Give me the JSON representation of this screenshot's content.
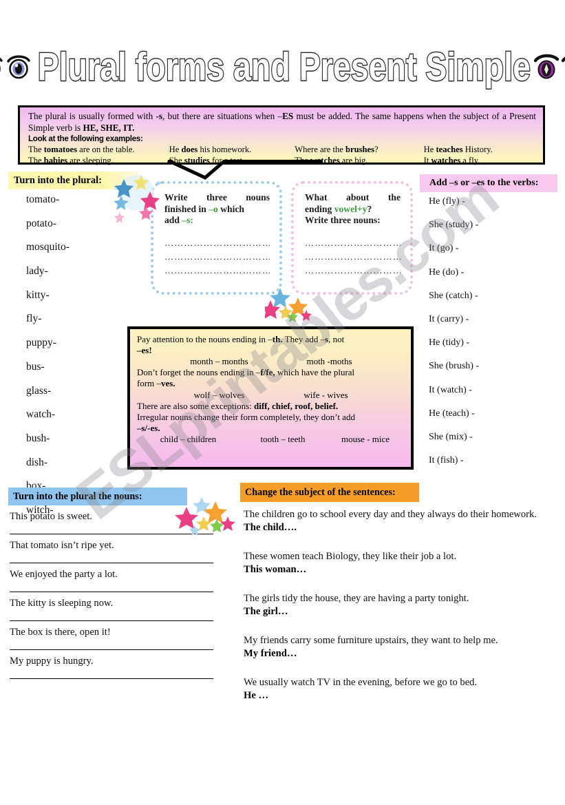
{
  "title": "Plural forms and Present Simple",
  "watermark": "ESLprintables.com",
  "intro": {
    "line1_a": "The plural is usually formed with ",
    "line1_b": "-s",
    "line1_c": ", but there are situations when –",
    "line1_d": "ES",
    "line1_e": " must be added. The same happens when the subject of a Present Simple verb is ",
    "line1_f": "HE, SHE, IT.",
    "lookat": "Look at the following examples:",
    "examples_row1": [
      {
        "pre": "The ",
        "bold": "tomatoes",
        "post": " are on the table."
      },
      {
        "pre": "He ",
        "bold": "does",
        "post": " his homework."
      },
      {
        "pre": "Where are the ",
        "bold": "brushes",
        "post": "?"
      },
      {
        "pre": "He ",
        "bold": "teaches",
        "post": " History."
      }
    ],
    "examples_row2": [
      {
        "pre": "The ",
        "bold": "babies",
        "post": " are sleeping."
      },
      {
        "pre": "She ",
        "bold": "studies",
        "post": " for a test."
      },
      {
        "pre": "The ",
        "bold": "watches",
        "post": " are big."
      },
      {
        "pre": "It ",
        "bold": "watches",
        "post": " a fly."
      }
    ]
  },
  "sections": {
    "plural_heading": "Turn into the plural:",
    "verbs_heading": "Add –s or –es to the verbs:",
    "plural_nouns_heading": "Turn into the plural the nouns:",
    "change_subject_heading": "Change the subject of the sentences:"
  },
  "noun_list": [
    "tomato-",
    "potato-",
    "mosquito-",
    "lady-",
    "kitty-",
    "fly-",
    "puppy-",
    "bus-",
    "glass-",
    "watch-",
    "bush-",
    "dish-",
    "box-",
    "witch-"
  ],
  "verb_list": [
    "He (fly) -",
    "She (study) -",
    "It (go) -",
    "He (do) -",
    "She (catch) -",
    "It (carry) -",
    "He (tidy) -",
    "She (brush) -",
    "It (watch) -",
    "He (teach) -",
    "She (mix) -",
    "It (fish) -"
  ],
  "task_box_1": {
    "l1": "Write three nouns",
    "l2_a": "finished in ",
    "l2_b": "–o",
    "l2_c": " which",
    "l3_a": "add ",
    "l3_b": "–s:",
    "blank": "……………………………."
  },
  "task_box_2": {
    "l1": "What about the",
    "l2_a": "ending ",
    "l2_b": "vowel+y",
    "l2_c": "?",
    "l3": "Write three nouns:",
    "blank": "……………………………."
  },
  "rules": {
    "p1_a": "Pay attention to the nouns ending in –",
    "p1_b": "th.",
    "p1_c": " They add –",
    "p1_d": "s",
    "p1_e": ", not",
    "p1_f": "–es!",
    "pair1_a": "month – months",
    "pair1_b": "moth -moths",
    "p2_a": "Don’t forget the nouns ending in –",
    "p2_b": "f/fe,",
    "p2_c": " which have the plural",
    "p2_d": "form –",
    "p2_e": "ves.",
    "pair2_a": "wolf – wolves",
    "pair2_b": "wife - wives",
    "p3_a": "There are also some exceptions: ",
    "p3_b": "diff, chief, roof, belief.",
    "p4_a": "Irregular nouns change their form completely, they don’t add",
    "p4_b": "–s/-es.",
    "pair3_a": "child – children",
    "pair3_b": "tooth – teeth",
    "pair3_c": "mouse - mice"
  },
  "plural_sentences": [
    "This potato is sweet.",
    "That tomato isn’t ripe yet.",
    "We enjoyed the party a lot.",
    "The kitty is sleeping now.",
    "The box is there, open it!",
    "My puppy is hungry."
  ],
  "subject_sentences": [
    {
      "sentence": "The children go to school every day and they always do their homework.",
      "answer": "The child…."
    },
    {
      "sentence": "These women teach Biology, they like their job a lot.",
      "answer": "This woman…"
    },
    {
      "sentence": "The girls tidy the house, they are having a party tonight.",
      "answer": "The girl…"
    },
    {
      "sentence": "My friends carry some furniture upstairs, they want to help me.",
      "answer": "My friend…"
    },
    {
      "sentence": "We usually watch TV in the evening, before we go to bed.",
      "answer": "He …"
    }
  ],
  "colors": {
    "bar_yellow": "#fdf6a8",
    "bar_pink": "#f8c8ef",
    "bar_blue": "#8fc5ef",
    "bar_orange": "#f59d28",
    "green_text": "#3d9b3d",
    "eye_left": "#8a8ed6",
    "eye_right": "#9b2ea0"
  }
}
